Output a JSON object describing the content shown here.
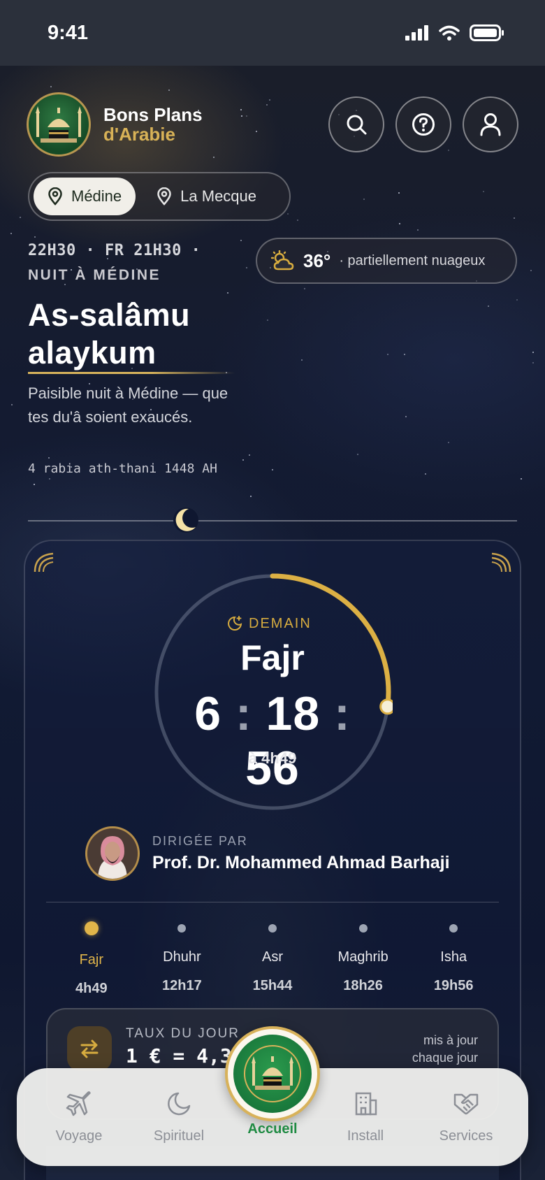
{
  "status_bar": {
    "time": "9:41"
  },
  "brand": {
    "line1": "Bons Plans",
    "line2": "d'Arabie"
  },
  "header_buttons": {
    "search": "search-icon",
    "help": "help-icon",
    "profile": "user-icon"
  },
  "cities": [
    {
      "label": "Médine",
      "active": true
    },
    {
      "label": "La Mecque",
      "active": false
    }
  ],
  "clock": {
    "line1": "22H30 · FR 21H30 ·",
    "line2": "NUIT À MÉDINE"
  },
  "weather": {
    "temp": "36°",
    "desc": "· partiellement nuageux",
    "icon": "partly-cloudy-icon"
  },
  "greeting": {
    "title": "As-salâmu alaykum",
    "subtitle": "Paisible nuit à Médine — que tes du'â soient exaucés.",
    "hijri": "4 rabia ath-thani 1448 AH"
  },
  "next_prayer": {
    "label": "DEMAIN",
    "name": "Fajr",
    "hours": "6",
    "minutes": "18",
    "seconds": "56",
    "at": "à 4h49",
    "progress": 0.27
  },
  "imam": {
    "label": "DIRIGÉE PAR",
    "name": "Prof. Dr. Mohammed Ahmad Barhaji"
  },
  "prayers": [
    {
      "name": "Fajr",
      "time": "4h49",
      "active": true
    },
    {
      "name": "Dhuhr",
      "time": "12h17",
      "active": false
    },
    {
      "name": "Asr",
      "time": "15h44",
      "active": false
    },
    {
      "name": "Maghrib",
      "time": "18h26",
      "active": false
    },
    {
      "name": "Isha",
      "time": "19h56",
      "active": false
    }
  ],
  "rate": {
    "label": "TAUX DU JOUR",
    "value": "1 € = 4,3",
    "note_line1": "mis à jour",
    "note_line2": "chaque jour"
  },
  "tabs": {
    "voyage": "Voyage",
    "spirituel": "Spirituel",
    "accueil": "Accueil",
    "install": "Install",
    "services": "Services"
  },
  "colors": {
    "gold": "#d7ac3f",
    "green": "#1f8b43",
    "background": "#111a33"
  }
}
